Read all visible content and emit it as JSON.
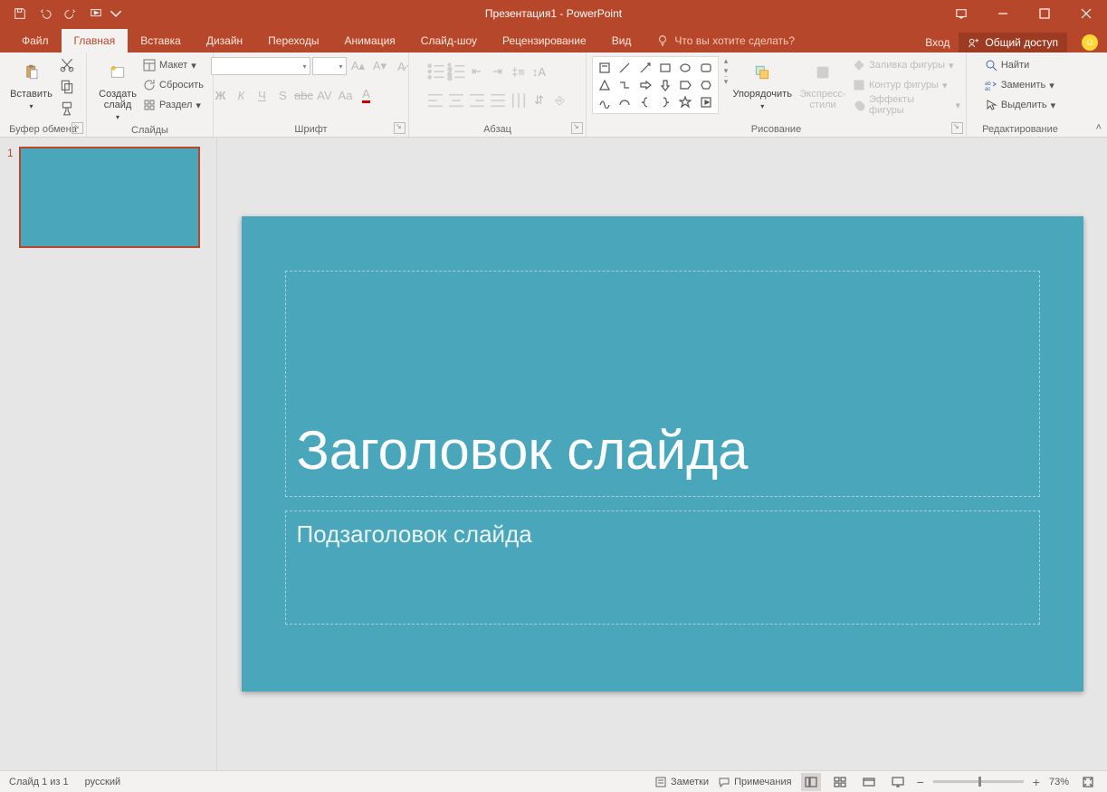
{
  "app": {
    "title": "Презентация1 - PowerPoint"
  },
  "tabs": {
    "file": "Файл",
    "home": "Главная",
    "insert": "Вставка",
    "design": "Дизайн",
    "transitions": "Переходы",
    "animations": "Анимация",
    "slideshow": "Слайд-шоу",
    "review": "Рецензирование",
    "view": "Вид",
    "tellme": "Что вы хотите сделать?",
    "signin": "Вход",
    "share": "Общий доступ"
  },
  "groups": {
    "clipboard": {
      "label": "Буфер обмена",
      "paste": "Вставить"
    },
    "slides": {
      "label": "Слайды",
      "new_slide": "Создать\nслайд",
      "layout": "Макет",
      "reset": "Сбросить",
      "section": "Раздел"
    },
    "font": {
      "label": "Шрифт",
      "font_name": "",
      "font_size": ""
    },
    "paragraph": {
      "label": "Абзац"
    },
    "drawing": {
      "label": "Рисование",
      "arrange": "Упорядочить",
      "quick_styles": "Экспресс-\nстили",
      "shape_fill": "Заливка фигуры",
      "shape_outline": "Контур фигуры",
      "shape_effects": "Эффекты фигуры"
    },
    "editing": {
      "label": "Редактирование",
      "find": "Найти",
      "replace": "Заменить",
      "select": "Выделить"
    }
  },
  "slide": {
    "number": "1",
    "title_placeholder": "Заголовок слайда",
    "subtitle_placeholder": "Подзаголовок слайда",
    "bg_color": "#4aa7bb"
  },
  "status": {
    "slide_indicator": "Слайд 1 из 1",
    "language": "русский",
    "notes": "Заметки",
    "comments": "Примечания",
    "zoom": "73%"
  }
}
